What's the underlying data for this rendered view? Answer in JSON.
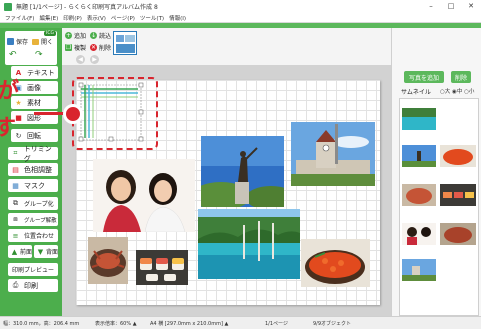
{
  "window": {
    "title": "無題 [1/1ページ] - らくらく印刷写真アルバム作成 8"
  },
  "menu": [
    "ファイル(F)",
    "編集(E)",
    "印刷(P)",
    "表示(V)",
    "ページ(P)",
    "ツール(T)",
    "情報(I)"
  ],
  "left_panel": {
    "badge": "ICG",
    "save": "保存",
    "open": "開く",
    "undo_icon": "undo-icon",
    "redo_icon": "redo-icon",
    "tools": [
      {
        "label": "テキスト",
        "icon": "A"
      },
      {
        "label": "画像",
        "icon": "▣"
      },
      {
        "label": "素材",
        "icon": "★"
      },
      {
        "label": "図形",
        "icon": "■"
      },
      {
        "label": "回転",
        "icon": "↻"
      },
      {
        "label": "トリミング",
        "icon": "⌗"
      },
      {
        "label": "色相調整",
        "icon": "▤"
      },
      {
        "label": "マスク",
        "icon": "▦"
      },
      {
        "label": "グループ化",
        "icon": "⧉"
      },
      {
        "label": "グループ解散",
        "icon": "⧈"
      },
      {
        "label": "位置合わせ",
        "icon": "≡"
      },
      {
        "label": "前面",
        "icon": "▲"
      },
      {
        "label": "背面",
        "icon": "▼"
      },
      {
        "label": "印刷プレビュー",
        "icon": ""
      },
      {
        "label": "印刷",
        "icon": "⎙"
      }
    ]
  },
  "page_toolbar": {
    "add": "追加",
    "read": "読込",
    "copy": "複製",
    "delete": "削除"
  },
  "overlay": {
    "ga": "が",
    "su": "す"
  },
  "right_panel": {
    "add_photo": "写真を追加",
    "delete": "削除",
    "thumbnail_label": "サムネイル",
    "size_options": "○大 ◉中 ○小"
  },
  "status": {
    "width": "幅：310.0 mm，高：206.4 mm",
    "zoom": "表示倍率：60% ▲",
    "paper": "A4 横 [297.0mm x 210.0mm] ▲",
    "page": "1/1ページ",
    "objects": "9/9オブジェクト"
  },
  "colors": {
    "accent_green": "#4cae4c",
    "highlight_red": "#d9252e"
  }
}
